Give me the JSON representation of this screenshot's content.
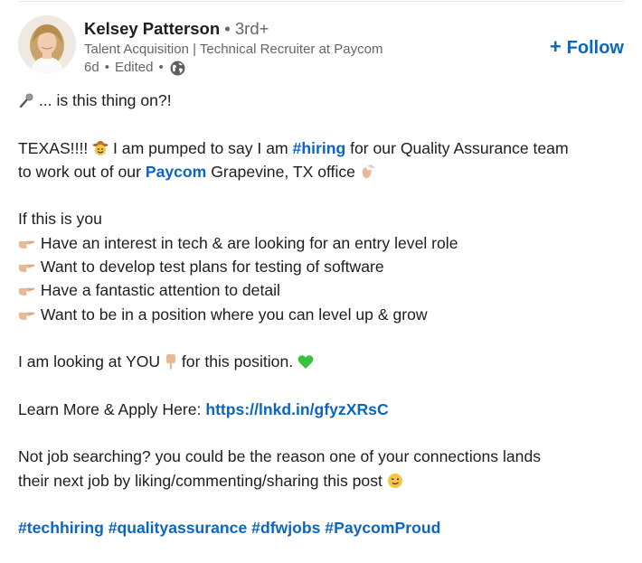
{
  "author": {
    "name": "Kelsey Patterson",
    "degree_separator": "•",
    "degree": "3rd+",
    "headline": "Talent Acquisition | Technical Recruiter at Paycom",
    "time": "6d",
    "edited": "Edited",
    "meta_sep": "•"
  },
  "follow": {
    "plus": "+",
    "label": "Follow"
  },
  "icons": {
    "avatar": "profile-photo",
    "globe": "globe-icon",
    "microphone": "microphone-icon",
    "cowboy": "cowboy-face-icon",
    "clap": "clapping-hands-icon",
    "pointing_right": "backhand-index-pointing-right-icon",
    "pointing_down": "backhand-index-pointing-down-icon",
    "green_heart": "green-heart-icon",
    "wink": "winking-face-icon"
  },
  "colors": {
    "link": "#0a66c2",
    "text": "#1d1d1d",
    "muted": "#666666"
  },
  "post": {
    "line1": " ... is this thing on?!",
    "line2_a": "TEXAS!!!! ",
    "line2_b": " I am pumped to say I am ",
    "line2_hashtag": "#hiring",
    "line2_c": " for our Quality Assurance team",
    "line3_a": "to work out of our ",
    "line3_mention": "Paycom",
    "line3_b": " Grapevine, TX office ",
    "line4": "If this is you",
    "bullets": [
      " Have an interest in tech & are looking for an entry level role",
      " Want to develop test plans for testing of software",
      " Have a fantastic attention to detail",
      " Want to be in a position where you can level up & grow"
    ],
    "line9_a": "I am looking at YOU ",
    "line9_b": " for this position. ",
    "line10_a": "Learn More & Apply Here: ",
    "line10_link": "https://lnkd.in/gfyzXRsC",
    "line11": "Not job searching? you could be the reason one of your connections lands",
    "line12": "their next job by liking/commenting/sharing this post ",
    "hashtags": [
      "#techhiring",
      "#qualityassurance",
      "#dfwjobs",
      "#PaycomProud"
    ]
  }
}
